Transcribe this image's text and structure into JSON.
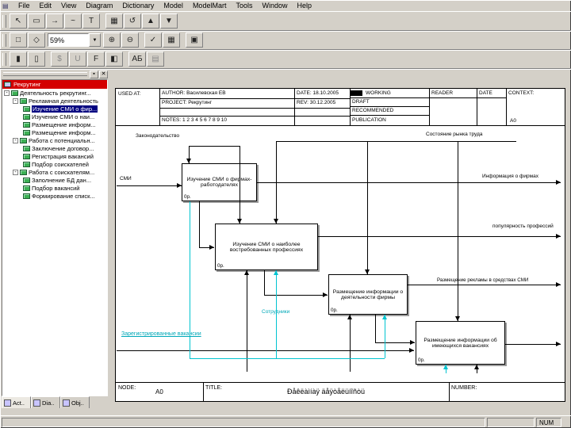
{
  "menubar": {
    "items": [
      "File",
      "Edit",
      "View",
      "Diagram",
      "Dictionary",
      "Model",
      "ModelMart",
      "Tools",
      "Window",
      "Help"
    ]
  },
  "icons": {
    "child_doc": "▤",
    "pointer": "↖",
    "activity_box": "▭",
    "arrow_tool": "→",
    "squiggle": "~",
    "text": "T",
    "dictionary": "▦",
    "undo": "↺",
    "up": "▲",
    "down": "▼",
    "new_diagram": "□",
    "sibling": "◇",
    "zoom_in": "⊕",
    "zoom_out": "⊖",
    "check": "✓",
    "grid_a": "▦",
    "grid_b": "▩",
    "misc": "▣",
    "lock": "▮",
    "unlock": "▯",
    "cost": "$",
    "udp": "U",
    "font": "F",
    "color": "◧",
    "abc": "АБ",
    "grid_c": "▤",
    "dropdown": "▼",
    "close": "✕",
    "pin": "▪",
    "minus": "-"
  },
  "toolbars": {
    "zoom_value": "59%"
  },
  "explorer": {
    "header": "Рекрутинг",
    "items": [
      {
        "label": "Деятельность рекрутинг..."
      },
      {
        "label": "Рекламная деятельность"
      },
      {
        "label": "Изучение СМИ о фир..."
      },
      {
        "label": "Изучение СМИ о наи..."
      },
      {
        "label": "Размещение информ..."
      },
      {
        "label": "Размещение информ..."
      },
      {
        "label": "Работа с потенциальн..."
      },
      {
        "label": "Заключение договор..."
      },
      {
        "label": "Регистрация вакансий"
      },
      {
        "label": "Подбор соискателей"
      },
      {
        "label": "Работа с соискателям..."
      },
      {
        "label": "Заполнение БД дан..."
      },
      {
        "label": "Подбор вакансий"
      },
      {
        "label": "Формирование списк..."
      }
    ],
    "tabs": [
      "Act..",
      "Dia..",
      "Obj.."
    ]
  },
  "kit": {
    "used_at": "USED AT:",
    "author_label": "AUTHOR:",
    "author": "Василевская ЕВ",
    "project_label": "PROJECT:",
    "project": "Рекрутинг",
    "date_label": "DATE:",
    "date": "18.10.2005",
    "rev_label": "REV:",
    "rev": "30.12.2005",
    "notes_label": "NOTES:",
    "notes": "1 2 3 4 5 6 7 8 9 10",
    "status": [
      "WORKING",
      "DRAFT",
      "RECOMMENDED",
      "PUBLICATION"
    ],
    "reader": "READER",
    "reader_date": "DATE",
    "context_label": "CONTEXT:",
    "context_node": "A0",
    "node_label": "NODE:",
    "node": "A0",
    "title_label": "TITLE:",
    "title": "Ðåêëàìíàÿ äåÿòåëüíîñòü",
    "number_label": "NUMBER:"
  },
  "diagram": {
    "boxes": [
      {
        "label": "Изучение СМИ о фирмах-работодателях",
        "cost": "0р."
      },
      {
        "label": "Изучение СМИ о наиболее востребованных профессиях",
        "cost": "0р."
      },
      {
        "label": "Размещение информации о деятельности фирмы",
        "cost": "0р."
      },
      {
        "label": "Размещение информации об имеющихся вакансиях",
        "cost": "0р."
      }
    ],
    "arrow_labels": {
      "legislation": "Законодательство",
      "labor_market": "Состояние рынка труда",
      "smi": "СМИ",
      "firm_info": "Информация о фирмах",
      "popularity": "популярность профессий",
      "ad_placement": "Размещение рекламы в средствах СМИ",
      "staff": "Сотрудники",
      "vacancies": "Зарегистрированные вакансии"
    }
  },
  "statusbar": {
    "num": "NUM"
  }
}
